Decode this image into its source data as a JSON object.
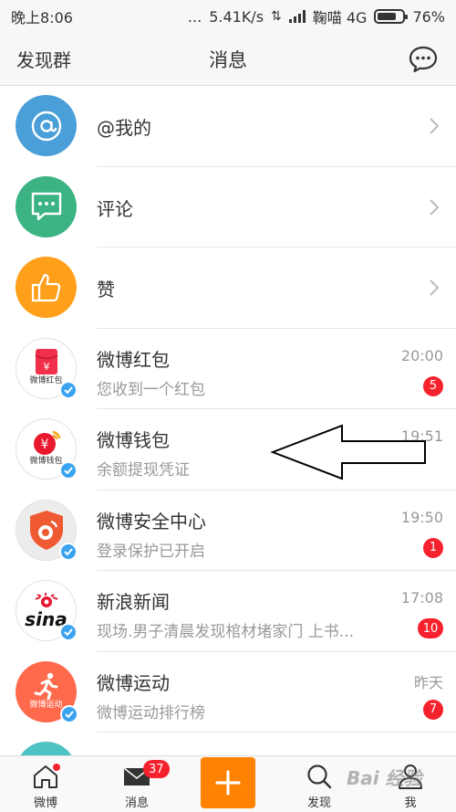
{
  "status_bar": {
    "time": "晚上8:06",
    "dots": "...",
    "network_speed": "5.41K/s",
    "carrier": "鞠喵 4G",
    "battery_percent": 76,
    "battery_text": "76%"
  },
  "header": {
    "left_link": "发现群",
    "title": "消息",
    "chat_icon": "chat-bubble-icon"
  },
  "simple_items": [
    {
      "label": "@我的",
      "icon": "at-icon",
      "color": "#4a9fd8"
    },
    {
      "label": "评论",
      "icon": "comment-icon",
      "color": "#3bb383"
    },
    {
      "label": "赞",
      "icon": "thumbs-up-icon",
      "color": "#ff9f1a"
    }
  ],
  "messages": [
    {
      "name": "微博红包",
      "preview": "您收到一个红包",
      "time": "20:00",
      "badge": "5",
      "avatar_caption": "微博红包"
    },
    {
      "name": "微博钱包",
      "preview": "余额提现凭证",
      "time": "19:51",
      "badge": "",
      "avatar_caption": "微博钱包"
    },
    {
      "name": "微博安全中心",
      "preview": "登录保护已开启",
      "time": "19:50",
      "badge": "1",
      "avatar_caption": ""
    },
    {
      "name": "新浪新闻",
      "preview": "现场.男子清晨发现棺材堵家门 上书...",
      "time": "17:08",
      "badge": "10",
      "avatar_caption": "sina"
    },
    {
      "name": "微博运动",
      "preview": "微博运动排行榜",
      "time": "昨天",
      "badge": "7",
      "avatar_caption": "微博运动"
    }
  ],
  "tabbar": {
    "tabs": [
      {
        "label": "微博",
        "icon": "home-icon"
      },
      {
        "label": "消息",
        "icon": "envelope-icon",
        "count": "37"
      },
      {
        "label": "",
        "icon": "plus-icon"
      },
      {
        "label": "发现",
        "icon": "search-icon"
      },
      {
        "label": "我",
        "icon": "person-icon"
      }
    ]
  },
  "watermark": "Bai 经验",
  "colors": {
    "accent": "#ff8200",
    "badge_red": "#f5222d",
    "verified_blue": "#3aa3f0"
  }
}
